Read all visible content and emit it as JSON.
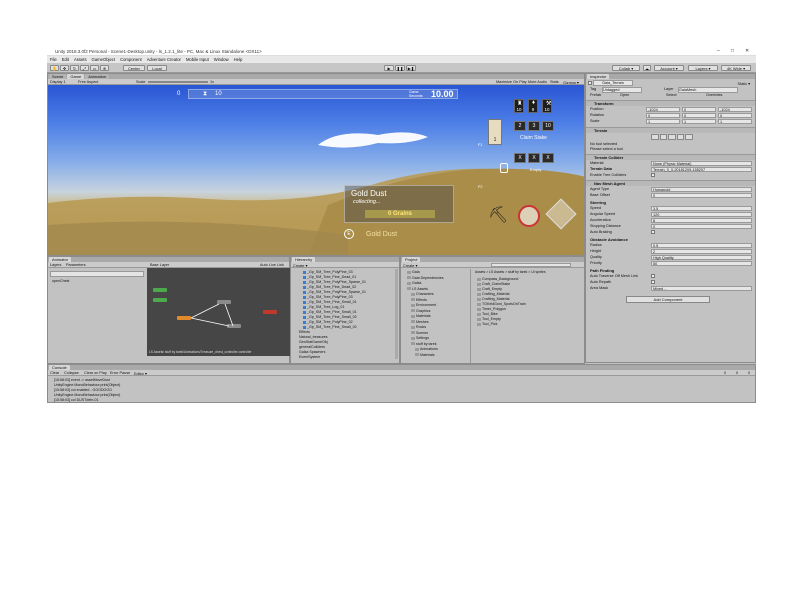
{
  "window": {
    "title": "Unity 2018.3.0f2 Personal - Scene1-Desktop.unity - ls_1.2.1_lite - PC, Mac & Linux Standalone <DX11>",
    "controls": [
      "–",
      "□",
      "✕"
    ]
  },
  "menu": [
    "File",
    "Edit",
    "Assets",
    "GameObject",
    "Component",
    "Adventure Creator",
    "Mobile Input",
    "Window",
    "Help"
  ],
  "toolbar": {
    "center": "Center",
    "local": "Local",
    "collab": "Collab ▾",
    "account": "Account ▾",
    "layers": "Layers ▾",
    "layout": "4K Wide ▾"
  },
  "game_panel": {
    "tabs": [
      "Scene",
      "Game",
      "Animation"
    ],
    "display": "Display 1",
    "aspect": "Free Aspect",
    "scale_label": "Scale",
    "scale_value": "1x",
    "options": [
      "Maximize On Play",
      "Mute Audio",
      "Stats",
      "Gizmos ▾"
    ]
  },
  "hud": {
    "top_left": [
      "0",
      "10"
    ],
    "top_label": "Game\nSeconds",
    "time": "10.00",
    "slots": [
      {
        "icon": "sword",
        "value": "10"
      },
      {
        "icon": "drop",
        "value": "9"
      },
      {
        "icon": "pick",
        "value": "10"
      }
    ],
    "counts": [
      "2",
      "3",
      "10"
    ],
    "claim_stake": "Claim Stake",
    "stake_count": "1",
    "empty_label": "Empty",
    "x_buttons": [
      "X",
      "X",
      "X"
    ],
    "pickup_title": "Gold Dust",
    "pickup_sub": "collecting...",
    "pickup_amount": "0 Grains",
    "item_label": "Gold Dust",
    "item_key": "E",
    "side_keys": [
      "F1",
      "F2"
    ]
  },
  "inspector": {
    "tab": "Inspector",
    "object": "Gaia_Terrain",
    "static": "Static ▾",
    "tag_label": "Tag",
    "tag": "Untagged",
    "layer_label": "Layer",
    "layer": "GaiaMesh",
    "prefab_label": "Prefab",
    "prefab_buttons": [
      "Open",
      "Select",
      "Overrides"
    ],
    "transform": "Transform",
    "position": {
      "label": "Position",
      "x": "-1024",
      "y": "0",
      "z": "-1024"
    },
    "rotation": {
      "label": "Rotation",
      "x": "0",
      "y": "0",
      "z": "0"
    },
    "scale": {
      "label": "Scale",
      "x": "1",
      "y": "1",
      "z": "1"
    },
    "terrain": "Terrain",
    "no_tool": "No tool selected",
    "select_tool": "Please select a tool",
    "collider": "Terrain Collider",
    "material_label": "Material",
    "material": "None (Physic Material)",
    "terrain_data_label": "Terrain Data",
    "terrain_data": "Terrain_0_0-20181209-155207",
    "enable_tree_label": "Enable Tree Colliders",
    "navmesh": "Nav Mesh Agent",
    "agent_type_label": "Agent Type",
    "agent_type": "Humanoid",
    "base_offset_label": "Base Offset",
    "base_offset": "0",
    "steering": "Steering",
    "speed_label": "Speed",
    "speed": "3.5",
    "angular_label": "Angular Speed",
    "angular": "120",
    "accel_label": "Acceleration",
    "accel": "8",
    "stopping_label": "Stopping Distance",
    "stopping": "0",
    "autobraking_label": "Auto Braking",
    "obstacle": "Obstacle Avoidance",
    "radius_label": "Radius",
    "radius": "0.5",
    "height_label": "Height",
    "height": "2",
    "quality_label": "Quality",
    "quality": "High Quality",
    "priority_label": "Priority",
    "priority": "50",
    "pathfinding": "Path Finding",
    "traverse_label": "Auto Traverse Off Mesh Link",
    "repath_label": "Auto Repath",
    "areamask_label": "Area Mask",
    "areamask": "Mixed ...",
    "add_component": "Add Component"
  },
  "animator": {
    "tab": "Animator",
    "subtabs": [
      "Layers",
      "Parameters"
    ],
    "layer": "Base Layer",
    "auto_live": "Auto Live Link",
    "param": "openChest",
    "footer": "LS Assets/ stuff by tarek/Animations/Treasure_chest_controller.controller"
  },
  "hierarchy": {
    "tab": "Hierarchy",
    "create": "Create ▾",
    "items": [
      "_Gp_SM_Tree_PolyPine_03",
      "_Gp_SM_Tree_Pine_Dead_01",
      "_Gp_SM_Tree_PolyPine_Sparse_01",
      "_Gp_SM_Tree_Pine_Dead_02",
      "_Gp_SM_Tree_PolyPine_Sparse_01",
      "_Gp_SM_Tree_PolyPine_03",
      "_Gp_SM_Tree_Pine_Small_01",
      "_Gp_SM_Tree_Log_01",
      "_Gp_SM_Tree_Pine_Small_01",
      "_Gp_SM_Tree_Pine_Small_02",
      "_Gp_SM_Tree_PolyPine_02",
      "_Gp_SM_Tree_Pine_Small_02",
      "Effects",
      "Natural_treasures",
      "GeoStatGameObj",
      "generalColliders",
      "Gaika Spawners",
      "EventSystem"
    ]
  },
  "project": {
    "tab": "Project",
    "create": "Create ▾",
    "folders": [
      "Gaia",
      "Gaia Dependencies",
      "Gaika",
      "LS Assets",
      "Characters",
      "Effects",
      "Environment",
      "Graphics",
      "Materials",
      "Meshes",
      "Rocks",
      "Scenes",
      "Settings",
      "stuff by tarek",
      "Animations",
      "Materials"
    ],
    "breadcrumb": "Assets > LS Assets > stuff by tarek > UI sprites",
    "files": [
      "Compass_Background",
      "Craft_ClaimStake",
      "Craft_Empty",
      "Crafting_Material",
      "Crafting_Material",
      "TGKeldGoni_SpotsOnTrain",
      "Timer_Polygon",
      "Tool_Bike",
      "Tool_Empty",
      "Tool_Pick"
    ]
  },
  "console": {
    "tab": "Console",
    "buttons": [
      "Clear",
      "Collapse",
      "Clear on Play",
      "Error Pause",
      "Editor ▾"
    ],
    "lines": [
      "[15:58:03] event -> assetMoveDust",
      "UnityEngine.MonoBehaviour:print(Object)",
      "[15:58:03] col enabled - GOODOOO",
      "UnityEngine.MonoBehaviour:print(Object)",
      "[15:58:03] col DUSTdetn-01"
    ],
    "counts": [
      "0",
      "0",
      "0"
    ]
  }
}
